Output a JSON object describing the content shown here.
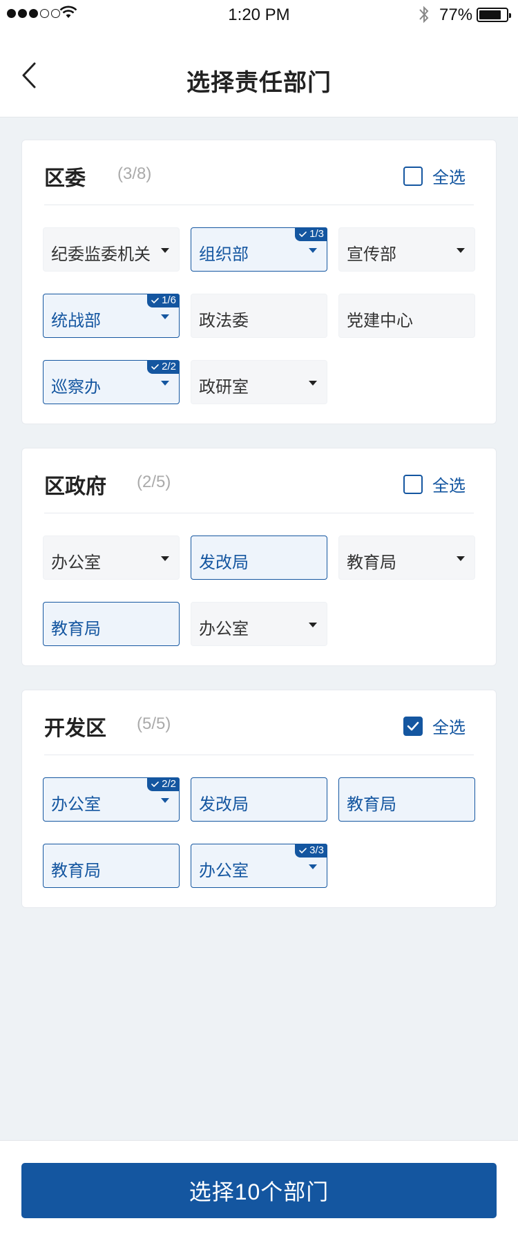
{
  "status_bar": {
    "time": "1:20 PM",
    "battery": "77%"
  },
  "nav": {
    "title": "选择责任部门"
  },
  "select_all_label": "全选",
  "sections": [
    {
      "title": "区委",
      "count": "(3/8)",
      "all_selected": false,
      "chips": [
        {
          "label": "纪委监委机关",
          "selected": false,
          "dropdown": true,
          "badge": null
        },
        {
          "label": "组织部",
          "selected": true,
          "dropdown": true,
          "badge": "1/3"
        },
        {
          "label": "宣传部",
          "selected": false,
          "dropdown": true,
          "badge": null
        },
        {
          "label": "统战部",
          "selected": true,
          "dropdown": true,
          "badge": "1/6"
        },
        {
          "label": "政法委",
          "selected": false,
          "dropdown": false,
          "badge": null
        },
        {
          "label": "党建中心",
          "selected": false,
          "dropdown": false,
          "badge": null
        },
        {
          "label": "巡察办",
          "selected": true,
          "dropdown": true,
          "badge": "2/2"
        },
        {
          "label": "政研室",
          "selected": false,
          "dropdown": true,
          "badge": null
        }
      ]
    },
    {
      "title": "区政府",
      "count": "(2/5)",
      "all_selected": false,
      "chips": [
        {
          "label": "办公室",
          "selected": false,
          "dropdown": true,
          "badge": null
        },
        {
          "label": "发改局",
          "selected": true,
          "dropdown": false,
          "badge": null
        },
        {
          "label": "教育局",
          "selected": false,
          "dropdown": true,
          "badge": null
        },
        {
          "label": "教育局",
          "selected": true,
          "dropdown": false,
          "badge": null
        },
        {
          "label": "办公室",
          "selected": false,
          "dropdown": true,
          "badge": null
        }
      ]
    },
    {
      "title": "开发区",
      "count": "(5/5)",
      "all_selected": true,
      "chips": [
        {
          "label": "办公室",
          "selected": true,
          "dropdown": true,
          "badge": "2/2"
        },
        {
          "label": "发改局",
          "selected": true,
          "dropdown": false,
          "badge": null
        },
        {
          "label": "教育局",
          "selected": true,
          "dropdown": false,
          "badge": null
        },
        {
          "label": "教育局",
          "selected": true,
          "dropdown": false,
          "badge": null
        },
        {
          "label": "办公室",
          "selected": true,
          "dropdown": true,
          "badge": "3/3"
        }
      ]
    }
  ],
  "footer": {
    "button_label": "选择10个部门"
  },
  "colors": {
    "accent": "#1456a0",
    "page_bg": "#eef2f5",
    "chip_bg": "#f5f6f8",
    "chip_selected_bg": "#eef4fb"
  }
}
